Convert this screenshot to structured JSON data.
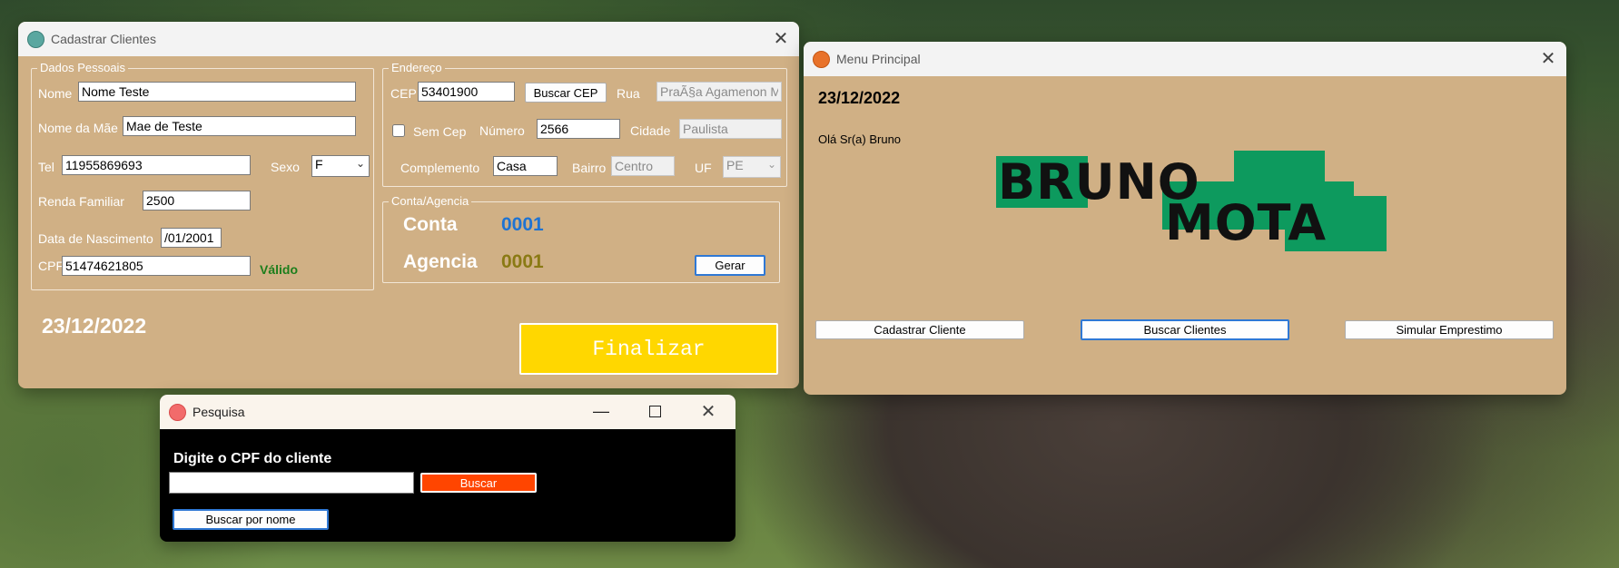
{
  "cadastro": {
    "title": "Cadastrar Clientes",
    "dados_pessoais": {
      "legend": "Dados Pessoais",
      "nome_label": "Nome",
      "nome_value": "Nome Teste",
      "mae_label": "Nome da Mãe",
      "mae_value": "Mae de Teste",
      "tel_label": "Tel",
      "tel_value": "11955869693",
      "sexo_label": "Sexo",
      "sexo_value": "F",
      "renda_label": "Renda Familiar",
      "renda_value": "2500",
      "nasc_label": "Data de Nascimento",
      "nasc_value": "/01/2001",
      "cpf_label": "CPF",
      "cpf_value": "51474621805",
      "cpf_status": "Válido"
    },
    "endereco": {
      "legend": "Endereço",
      "cep_label": "CEP",
      "cep_value": "53401900",
      "buscar_cep": "Buscar CEP",
      "rua_label": "Rua",
      "rua_value": "PraÃ§a Agamenon Ma",
      "sem_cep_label": "Sem Cep",
      "numero_label": "Número",
      "numero_value": "2566",
      "cidade_label": "Cidade",
      "cidade_value": "Paulista",
      "complemento_label": "Complemento",
      "complemento_value": "Casa",
      "bairro_label": "Bairro",
      "bairro_value": "Centro",
      "uf_label": "UF",
      "uf_value": "PE"
    },
    "conta_agencia": {
      "legend": "Conta/Agencia",
      "conta_label": "Conta",
      "conta_value": "0001",
      "agencia_label": "Agencia",
      "agencia_value": "0001",
      "gerar": "Gerar"
    },
    "date": "23/12/2022",
    "finalizar": "Finalizar"
  },
  "menu": {
    "title": "Menu Principal",
    "date": "23/12/2022",
    "greeting": "Olá Sr(a) Bruno",
    "logo_line1": "BRUNO",
    "logo_line2": "MOTA",
    "buttons": [
      "Cadastrar Cliente",
      "Buscar Clientes",
      "Simular Emprestimo"
    ]
  },
  "pesquisa": {
    "title": "Pesquisa",
    "prompt": "Digite o CPF do cliente",
    "cpf_value": "",
    "buscar": "Buscar",
    "buscar_nome": "Buscar por nome"
  },
  "colors": {
    "form_bg": "#d0b085",
    "conta_value": "#1e73d2",
    "agencia_value": "#8a7a14",
    "valid": "#1c7e1c",
    "finalizar_bg": "#ffd700",
    "logo_green": "#0d9a5e",
    "buscar_bg": "#ff4500",
    "pesquisa_bg": "#000000"
  },
  "icons": {
    "cadastro": "form-app-icon",
    "menu": "orange-app-icon",
    "pesquisa": "pink-app-icon",
    "close": "close-icon",
    "maximize": "maximize-icon",
    "minimize": "minimize-icon",
    "dropdown": "chevron-down-icon"
  }
}
